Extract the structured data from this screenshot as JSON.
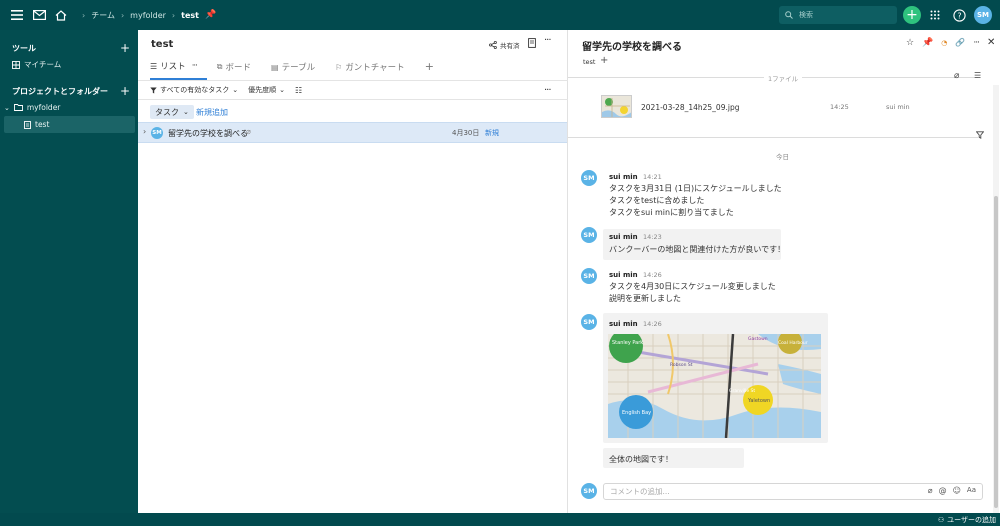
{
  "topbar": {
    "breadcrumbs": [
      "チーム",
      "myfolder",
      "test"
    ],
    "search_placeholder": "検索",
    "user_initials": "SM"
  },
  "sidebar": {
    "tools_heading": "ツール",
    "my_team": "マイチーム",
    "projects_heading": "プロジェクトとフォルダー",
    "folder": "myfolder",
    "project": "test"
  },
  "center": {
    "title": "test",
    "share_label": "共有済",
    "tabs": [
      "リスト",
      "ボード",
      "テーブル",
      "ガントチャート"
    ],
    "filter_all": "すべての有効なタスク",
    "sort_priority": "優先度順",
    "group_label": "タスク",
    "new_add": "新規追加",
    "task": {
      "avatar": "SM",
      "title": "留学先の学校を調べる",
      "due": "4月30日",
      "status": "新規"
    }
  },
  "detail": {
    "title": "留学先の学校を調べる",
    "tag": "test",
    "files_label": "1ファイル",
    "file": {
      "name": "2021-03-28_14h25_09.jpg",
      "time": "14:25",
      "user": "sui min"
    },
    "today_label": "今日",
    "comment_placeholder": "コメントの追加...",
    "comment_aa": "Aa",
    "messages": [
      {
        "avatar": "SM",
        "user": "sui min",
        "time": "14:21",
        "lines": [
          "タスクを3月31日 (1日)にスケジュールしました",
          "タスクをtestに含めました",
          "タスクをsui minに割り当てました"
        ]
      },
      {
        "avatar": "SM",
        "user": "sui min",
        "time": "14:23",
        "lines": [
          "バンクーバーの地図と関連付けた方が良いです！"
        ]
      },
      {
        "avatar": "SM",
        "user": "sui min",
        "time": "14:26",
        "lines": [
          "タスクを4月30日にスケジュール変更しました",
          "説明を更新しました"
        ]
      },
      {
        "avatar": "SM",
        "user": "sui min",
        "time": "14:26",
        "lines": []
      },
      {
        "avatar": "",
        "user": "",
        "time": "",
        "lines": [
          "全体の地図です！"
        ]
      }
    ],
    "map_labels": [
      "Stanley Park",
      "English Bay",
      "Robson St",
      "Granville St",
      "Yaletown",
      "Gastown",
      "Coal Harbour"
    ]
  },
  "statusbar": {
    "add_user": "ユーザーの追加"
  }
}
